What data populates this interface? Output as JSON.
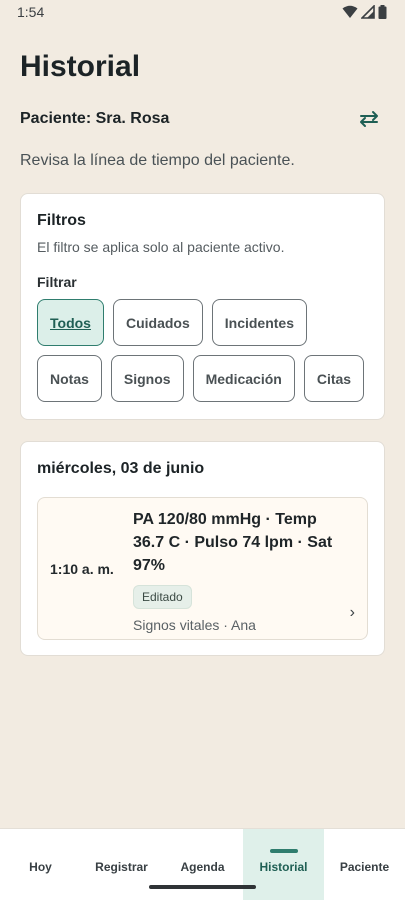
{
  "status_bar": {
    "time": "1:54"
  },
  "header": {
    "title": "Historial",
    "patient_label": "Paciente: Sra. Rosa",
    "subtitle": "Revisa la línea de tiempo del paciente."
  },
  "filters": {
    "title": "Filtros",
    "note": "El filtro se aplica solo al paciente activo.",
    "filter_label": "Filtrar",
    "chips": [
      "Todos",
      "Cuidados",
      "Incidentes",
      "Notas",
      "Signos",
      "Medicación",
      "Citas"
    ],
    "selected": "Todos"
  },
  "timeline": {
    "date": "miércoles, 03 de junio",
    "entries": [
      {
        "time": "1:10 a. m.",
        "text": "PA 120/80 mmHg · Temp 36.7 C · Pulso 74 lpm · Sat 97%",
        "badge": "Editado",
        "meta": "Signos vitales · Ana"
      }
    ]
  },
  "nav": {
    "items": [
      "Hoy",
      "Registrar",
      "Agenda",
      "Historial",
      "Paciente"
    ],
    "active": "Historial"
  },
  "colors": {
    "background": "#f2ebe1",
    "accent": "#2f7d6e",
    "accent_light": "#dcefe9"
  }
}
